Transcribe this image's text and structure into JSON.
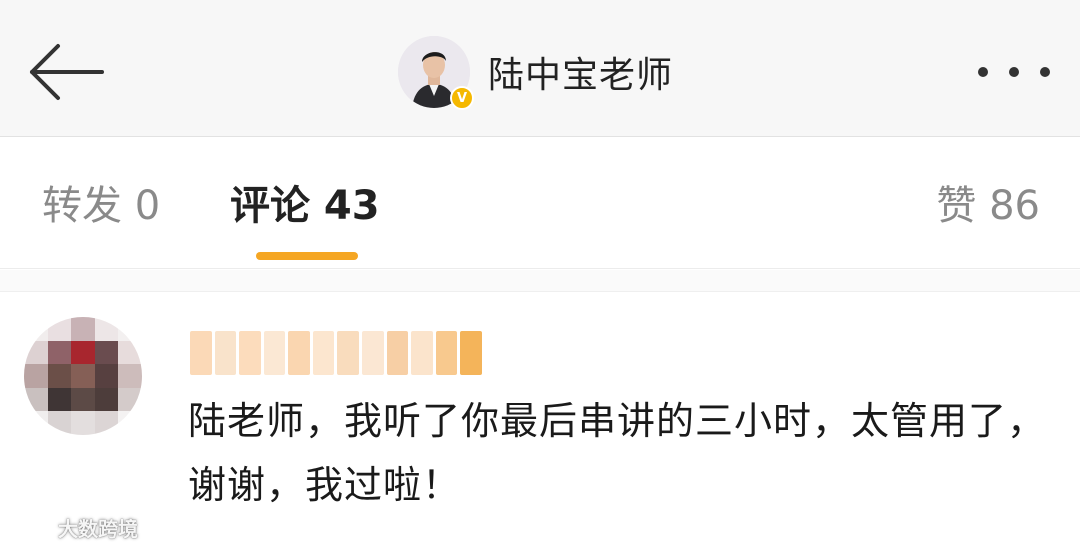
{
  "header": {
    "back_icon": "arrow-left-icon",
    "author_name": "陆中宝老师",
    "verified_mark": "V",
    "more_icon": "more-dots-icon"
  },
  "tabs": {
    "repost_label": "转发 0",
    "comments_label": "评论 43",
    "likes_label": "赞 86",
    "active": "comments",
    "accent_color": "#f5a623"
  },
  "comment": {
    "text": "陆老师，我听了你最后串讲的三小时，太管用了，谢谢，我过啦！"
  },
  "watermark": {
    "text": "大数跨境"
  },
  "colors": {
    "header_bg": "#f7f7f7",
    "verified_badge": "#f5b800",
    "inactive_tab": "#8a8a8a"
  }
}
